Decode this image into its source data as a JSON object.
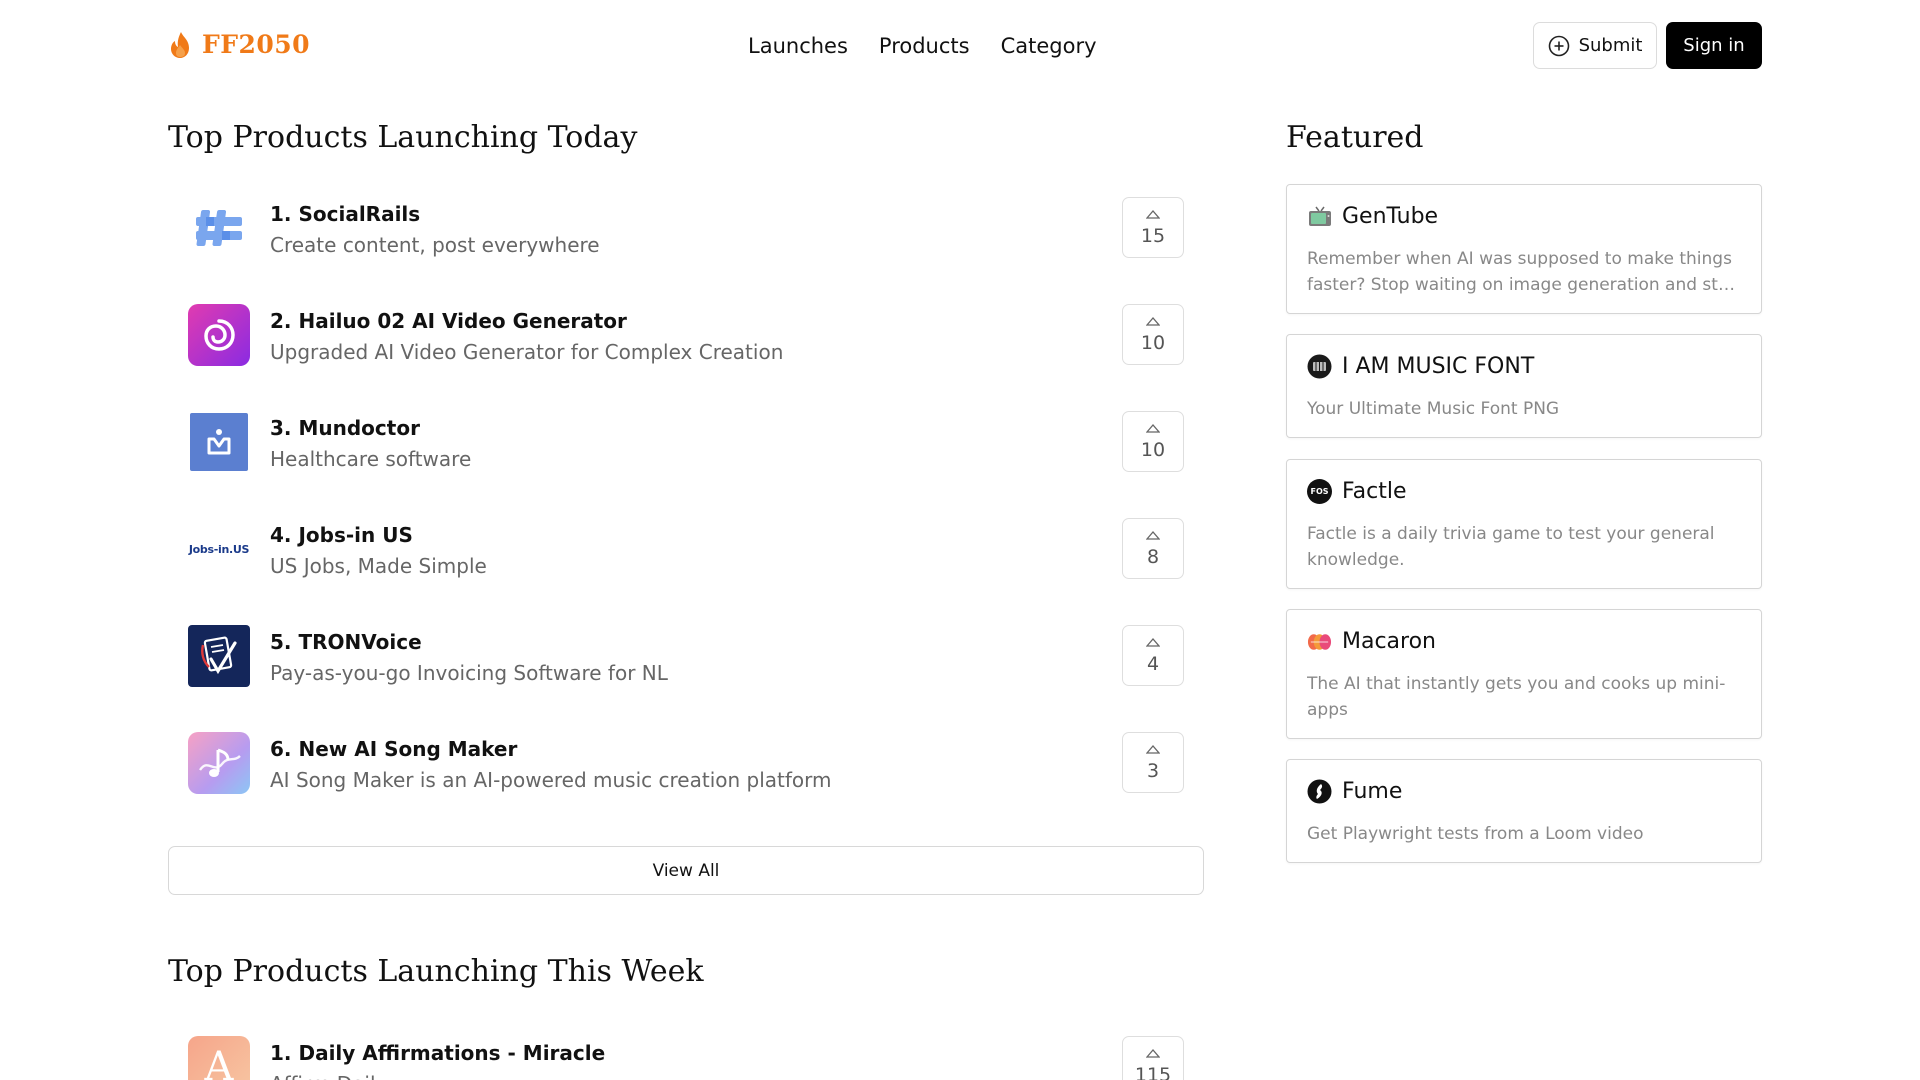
{
  "header": {
    "logo_text": "FF2050",
    "nav": [
      "Launches",
      "Products",
      "Category"
    ],
    "submit_label": "Submit",
    "signin_label": "Sign in"
  },
  "today": {
    "title": "Top Products Launching Today",
    "products": [
      {
        "name": "1. SocialRails",
        "tagline": "Create content, post everywhere",
        "votes": "15"
      },
      {
        "name": "2. Hailuo 02 AI Video Generator",
        "tagline": "Upgraded AI Video Generator for Complex Creation",
        "votes": "10"
      },
      {
        "name": "3. Mundoctor",
        "tagline": "Healthcare software",
        "votes": "10"
      },
      {
        "name": "4. Jobs-in US",
        "tagline": "US Jobs, Made Simple",
        "votes": "8",
        "logo_text": "Jobs-in.US"
      },
      {
        "name": "5. TRONVoice",
        "tagline": "Pay-as-you-go Invoicing Software for NL",
        "votes": "4"
      },
      {
        "name": "6. New AI Song Maker",
        "tagline": "AI Song Maker is an AI-powered music creation platform",
        "votes": "3"
      }
    ],
    "view_all": "View All"
  },
  "week": {
    "title": "Top Products Launching This Week",
    "products": [
      {
        "name": "1. Daily Affirmations - Miracle",
        "tagline": "Affirm Daily",
        "votes": "115",
        "logo_text": "A"
      }
    ]
  },
  "featured": {
    "title": "Featured",
    "items": [
      {
        "name": "GenTube",
        "desc": "Remember when AI was supposed to make things faster? Stop waiting on image generation and start creating.",
        "icon": "tv-icon"
      },
      {
        "name": "I AM MUSIC FONT",
        "desc": "Your Ultimate Music Font PNG",
        "icon": "music-font-icon"
      },
      {
        "name": "Factle",
        "desc": "Factle is a daily trivia game to test your general knowledge.",
        "icon": "fos-icon",
        "logo_text": "FOS"
      },
      {
        "name": "Macaron",
        "desc": "The AI that instantly gets you and cooks up mini-apps",
        "icon": "macaron-icon"
      },
      {
        "name": "Fume",
        "desc": "Get Playwright tests from a Loom video",
        "icon": "fume-icon"
      }
    ]
  },
  "colors": {
    "brand": "#f07a18",
    "signin_bg": "#000000",
    "muted_text": "#666666"
  }
}
